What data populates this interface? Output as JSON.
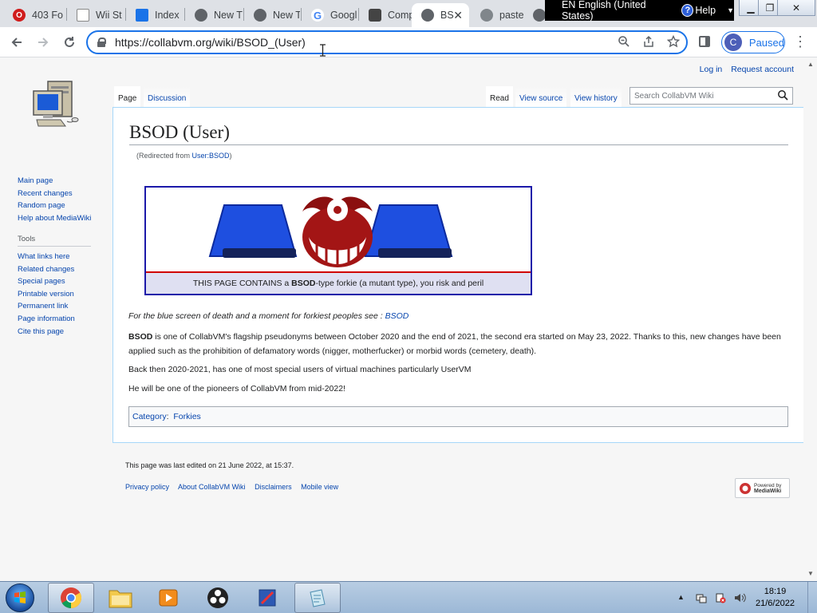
{
  "browser": {
    "tabs": [
      {
        "title": "403 Fo",
        "icon": "opera-icon"
      },
      {
        "title": "Wii St",
        "icon": "page-icon"
      },
      {
        "title": "Index",
        "icon": "index-icon"
      },
      {
        "title": "New T",
        "icon": "new-tab-icon"
      },
      {
        "title": "New T",
        "icon": "new-tab-icon"
      },
      {
        "title": "Googl",
        "icon": "google-icon"
      },
      {
        "title": "Comp",
        "icon": "computer-icon"
      },
      {
        "title": "BS",
        "icon": "globe-icon",
        "active": true
      },
      {
        "title": "pastel",
        "icon": "globe-icon"
      }
    ],
    "language_bar": {
      "language": "EN English (United States)",
      "help_label": "Help"
    },
    "url": "https://collabvm.org/wiki/BSOD_(User)",
    "profile": {
      "initial": "C",
      "status": "Paused"
    },
    "accent": "#1a73e8"
  },
  "wiki": {
    "personal": {
      "login": "Log in",
      "request": "Request account"
    },
    "nav": {
      "main": [
        "Main page",
        "Recent changes",
        "Random page",
        "Help about MediaWiki"
      ],
      "tools_heading": "Tools",
      "tools": [
        "What links here",
        "Related changes",
        "Special pages",
        "Printable version",
        "Permanent link",
        "Page information",
        "Cite this page"
      ]
    },
    "tabs": {
      "page": "Page",
      "discussion": "Discussion",
      "read": "Read",
      "view_source": "View source",
      "view_history": "View history"
    },
    "search_placeholder": "Search CollabVM Wiki",
    "title": "BSOD (User)",
    "redirect": {
      "prefix": "(Redirected from ",
      "link": "User:BSOD",
      "suffix": ")"
    },
    "banner": {
      "pre": "THIS PAGE CONTAINS a ",
      "bold": "BSOD",
      "post": "-type forkie (a mutant type), you risk and peril"
    },
    "hatnote": {
      "text": "For the blue screen of death and a moment for forkiest peoples see : ",
      "link": "BSOD"
    },
    "p1": {
      "bold": "BSOD",
      "text": " is one of CollabVM's flagship pseudonyms between October 2020 and the end of 2021, the second era started on May 23, 2022. Thanks to this, new changes have been applied such as the prohibition of defamatory words (nigger, motherfucker) or morbid words (cemetery, death)."
    },
    "p2": "Back then 2020-2021, has one of most special users of virtual machines particularly UserVM",
    "p3": "He will be one of the pioneers of CollabVM from mid-2022!",
    "category": {
      "label": "Category",
      "value": "Forkies"
    },
    "last_edited": "This page was last edited on 21 June 2022, at 15:37.",
    "footer_links": [
      "Privacy policy",
      "About CollabVM Wiki",
      "Disclaimers",
      "Mobile view"
    ],
    "powered": {
      "line1": "Powered by",
      "line2": "MediaWiki"
    }
  },
  "taskbar": {
    "time": "18:19",
    "date": "21/6/2022"
  }
}
